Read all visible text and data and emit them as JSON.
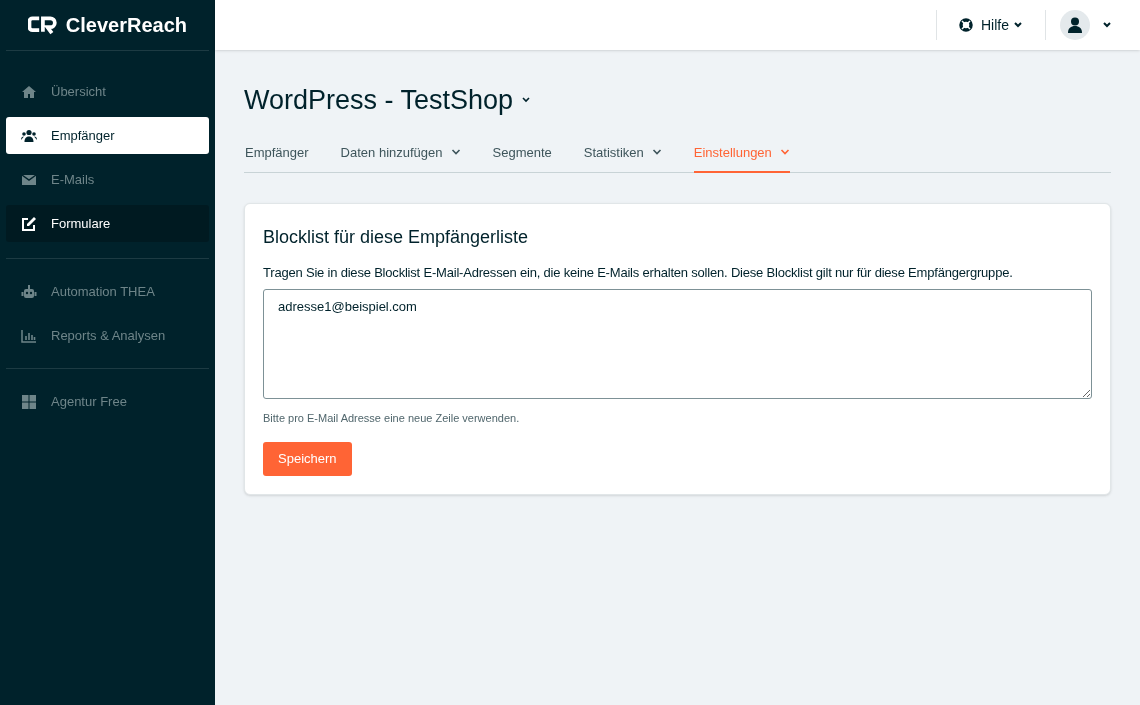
{
  "logo": {
    "text": "CleverReach"
  },
  "sidebar": {
    "groups": [
      [
        {
          "label": "Übersicht",
          "kind": "home",
          "selected": false,
          "hovered": false
        },
        {
          "label": "Empfänger",
          "kind": "users",
          "selected": true,
          "hovered": false
        },
        {
          "label": "E-Mails",
          "kind": "mail",
          "selected": false,
          "hovered": false
        },
        {
          "label": "Formulare",
          "kind": "edit",
          "selected": false,
          "hovered": true
        }
      ],
      [
        {
          "label": "Automation THEA",
          "kind": "robot",
          "selected": false,
          "hovered": false
        },
        {
          "label": "Reports & Analysen",
          "kind": "chart",
          "selected": false,
          "hovered": false
        }
      ],
      [
        {
          "label": "Agentur Free",
          "kind": "grid",
          "selected": false,
          "hovered": false
        }
      ]
    ]
  },
  "topbar": {
    "help": "Hilfe"
  },
  "page": {
    "title": "WordPress - TestShop"
  },
  "tabs": [
    {
      "label": "Empfänger",
      "dropdown": false,
      "selected": false
    },
    {
      "label": "Daten hinzufügen",
      "dropdown": true,
      "selected": false
    },
    {
      "label": "Segmente",
      "dropdown": false,
      "selected": false
    },
    {
      "label": "Statistiken",
      "dropdown": true,
      "selected": false
    },
    {
      "label": "Einstellungen",
      "dropdown": true,
      "selected": true
    }
  ],
  "card": {
    "title": "Blocklist für diese Empfängerliste",
    "description": "Tragen Sie in diese Blocklist E-Mail-Adressen ein, die keine E-Mails erhalten sollen. Diese Blocklist gilt nur für diese Empfängergruppe.",
    "value": "adresse1@beispiel.com",
    "hint": "Bitte pro E-Mail Adresse eine neue Zeile verwenden.",
    "button": "Speichern"
  }
}
